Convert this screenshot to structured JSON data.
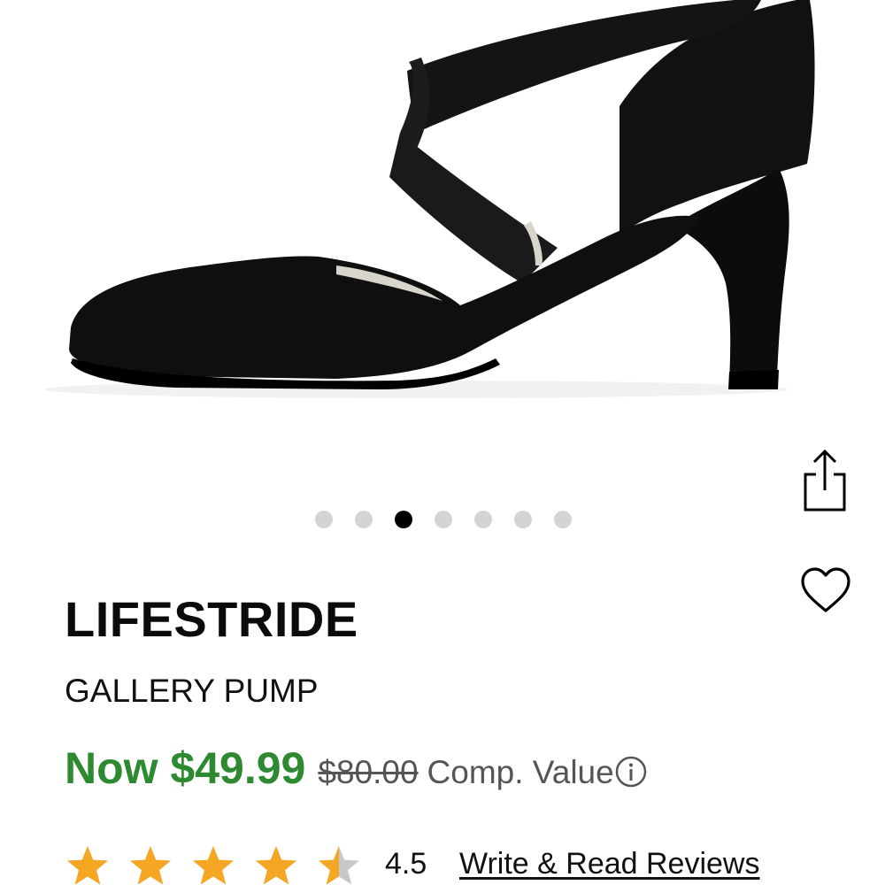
{
  "product": {
    "brand": "LIFESTRIDE",
    "name": "GALLERY PUMP",
    "price_now": "Now $49.99",
    "price_comp": "$80.00",
    "comp_label": "Comp. Value",
    "rating": "4.5",
    "rating_fraction": 0.9,
    "reviews_link": "Write & Read Reviews"
  },
  "carousel": {
    "total_images": 7,
    "active_index": 2
  },
  "icons": {
    "share": "share-icon",
    "favorite": "heart-icon",
    "info": "info-icon",
    "star": "star-icon"
  },
  "colors": {
    "price_green": "#2d8a30",
    "star_gold": "#f5a623",
    "star_empty": "#c8c8c8",
    "dot_active": "#000000",
    "dot_inactive": "#d4d4d4"
  }
}
